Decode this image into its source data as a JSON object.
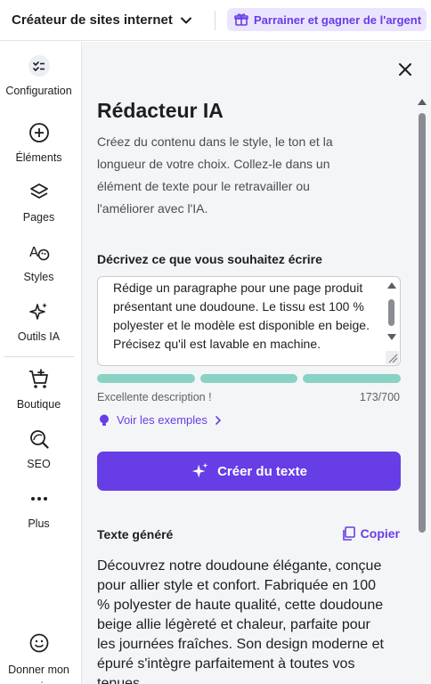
{
  "topbar": {
    "site_switcher_label": "Créateur de sites internet",
    "refer_label": "Parrainer et gagner de l'argent"
  },
  "sidebar": {
    "items": [
      {
        "label": "Configuration",
        "icon": "checklist-icon"
      },
      {
        "label": "Éléments",
        "icon": "plus-circle-icon"
      },
      {
        "label": "Pages",
        "icon": "layers-icon"
      },
      {
        "label": "Styles",
        "icon": "palette-icon"
      },
      {
        "label": "Outils IA",
        "icon": "sparkles-icon"
      },
      {
        "label": "Boutique",
        "icon": "cart-icon"
      },
      {
        "label": "SEO",
        "icon": "seo-search-icon"
      },
      {
        "label": "Plus",
        "icon": "more-dots-icon"
      },
      {
        "label": "Donner mon avis",
        "icon": "feedback-smile-icon"
      }
    ]
  },
  "panel": {
    "title": "Rédacteur IA",
    "description": "Créez du contenu dans le style, le ton et la longueur de votre choix. Collez-le dans un élément de texte pour le retravailler ou l'améliorer avec l'IA.",
    "prompt_label": "Décrivez ce que vous souhaitez écrire",
    "prompt_value": "Rédige un paragraphe pour une page produit présentant une doudoune. Le tissu est 100 % polyester et le modèle est disponible en beige. Précisez qu'il est lavable en machine.",
    "quality_label": "Excellente description !",
    "char_count": "173/700",
    "examples_link": "Voir les exemples",
    "create_button": "Créer du texte",
    "generated_label": "Texte généré",
    "copy_button": "Copier",
    "generated_text": "Découvrez notre doudoune élégante, conçue pour allier style et confort. Fabriquée en 100 % polyester de haute qualité, cette doudoune beige allie légèreté et chaleur, parfaite pour les journées fraîches. Son design moderne et épuré s'intègre parfaitement à toutes vos tenues."
  },
  "colors": {
    "accent": "#673de6",
    "accent_soft": "#ebe4ff",
    "quality_bar": "#8ad2c3",
    "panel_bg": "#f4f5f7"
  }
}
